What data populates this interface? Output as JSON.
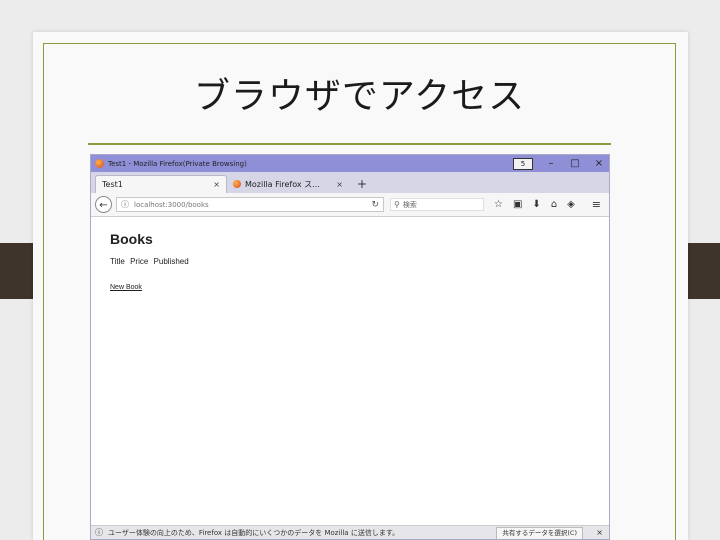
{
  "slide": {
    "title": "ブラウザでアクセス"
  },
  "browser": {
    "window_title": "Test1 - Mozilla Firefox(Private Browsing)",
    "window_controls": {
      "box": "5",
      "minimize": "–",
      "maximize": "□",
      "close": "×"
    },
    "tabs": [
      {
        "label": "Test1",
        "close": "×"
      },
      {
        "label": "Mozilla Firefox ス...",
        "close": "×"
      }
    ],
    "new_tab": "+",
    "url": "localhost:3000/books",
    "url_info": "ⓘ",
    "reload": "↻",
    "search_placeholder": "検索",
    "toolbar_icons": {
      "bookmark": "☆",
      "library": "▣",
      "download": "⬇",
      "home": "⌂",
      "pocket": "◈"
    },
    "menu": "≡"
  },
  "page": {
    "heading": "Books",
    "columns": [
      "Title",
      "Price",
      "Published"
    ],
    "new_link": "New Book"
  },
  "notification": {
    "text": "ユーザー体験の向上のため、Firefox は自動的にいくつかのデータを Mozilla に送信します。",
    "button": "共有するデータを選択(C)",
    "close": "×"
  },
  "colors": {
    "accent": "#8e9b3a",
    "titlebar": "#8f8fd8",
    "binder": "#3e342c"
  }
}
